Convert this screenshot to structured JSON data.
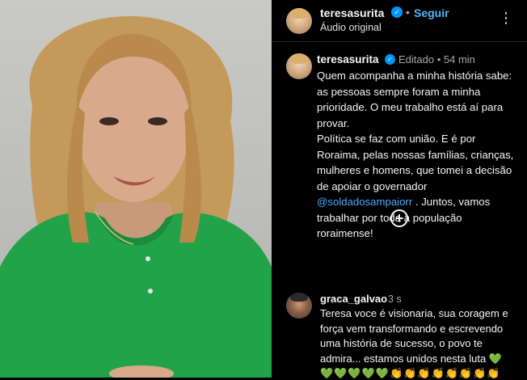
{
  "header": {
    "username": "teresasurita",
    "follow_label": "Seguir",
    "audio_label": "Áudio original",
    "separator": "•",
    "more_label": "⋮"
  },
  "caption": {
    "username": "teresasurita",
    "meta": "Editado • 54 min",
    "text_part1": "Quem acompanha a minha história sabe: as pessoas sempre foram a minha prioridade. O meu trabalho está aí para provar.\nPolítica se faz com união. E é por Roraima, pelas nossas famílias, crianças, mulheres e homens, que tomei a decisão de apoiar o governador ",
    "mention": "@soldadosampaiorr",
    "text_part2": " . Juntos, vamos trabalhar por toda a população roraimense!"
  },
  "add_button_label": "+",
  "comment": {
    "username": "graca_galvao",
    "time": "3 s",
    "text": "Teresa voce é visionaria, sua coragem e força vem transformando e escrevendo uma história de sucesso, o povo te admira... estamos unidos nesta luta 💚",
    "emojis_hearts": "💚💚💚💚💚",
    "emojis_claps": "👏👏👏👏👏👏👏👏"
  },
  "colors": {
    "accent_blue": "#0095f6",
    "follow_blue": "#4cb5f9",
    "background": "#000000",
    "shirt_green": "#22a34a"
  }
}
